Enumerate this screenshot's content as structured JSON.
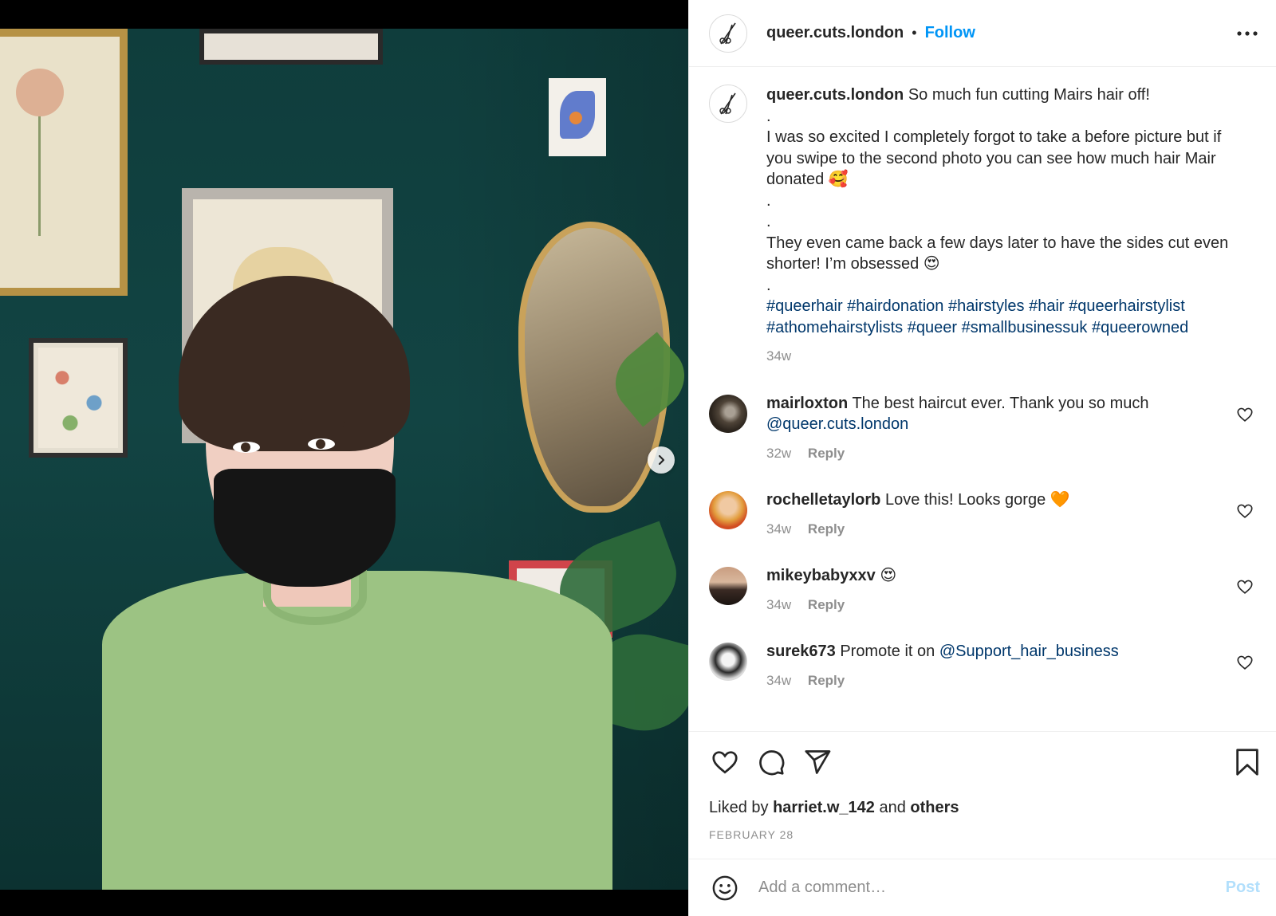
{
  "post": {
    "username": "queer.cuts.london",
    "follow_label": "Follow",
    "separator": "•",
    "media_alt": "Person with short dark haircut wearing a black face mask and green sweater in front of a dark teal wall with framed pictures"
  },
  "caption": {
    "username": "queer.cuts.london",
    "line1": "So much fun cutting Mairs hair off!",
    "dot1": ".",
    "line2": "I was so excited I completely forgot to take a before picture but if you swipe to the second photo you can see how much hair Mair donated 🥰",
    "dot2": ".",
    "dot3": ".",
    "line3": "They even came back a few days later to have the sides cut even shorter! I’m obsessed 😍",
    "dot4": ".",
    "hashtags": "#queerhair #hairdonation #hairstyles #hair #queerhairstylist #athomehairstylists #queer #smallbusinessuk #queerowned",
    "time": "34w"
  },
  "comments": [
    {
      "username": "mairloxton",
      "text": "The best haircut ever. Thank you so much",
      "mention": "@queer.cuts.london",
      "time": "32w",
      "reply": "Reply"
    },
    {
      "username": "rochelletaylorb",
      "text": "Love this! Looks gorge 🧡",
      "time": "34w",
      "reply": "Reply"
    },
    {
      "username": "mikeybabyxxv",
      "text": "😍",
      "time": "34w",
      "reply": "Reply"
    },
    {
      "username": "surek673",
      "text": "Promote it on",
      "mention": "@Support_hair_business",
      "time": "34w",
      "reply": "Reply"
    }
  ],
  "actions": {
    "liked_by_prefix": "Liked by",
    "liked_by_user": "harriet.w_142",
    "and": "and",
    "others": "others",
    "date": "FEBRUARY 28"
  },
  "add_comment": {
    "placeholder": "Add a comment…",
    "post_label": "Post"
  },
  "icons": {
    "logo": "scissors-icon",
    "more": "more-horizontal-icon",
    "carousel": "chevron-right-icon",
    "like": "heart-icon",
    "comment": "comment-icon",
    "share": "paper-plane-icon",
    "save": "bookmark-icon",
    "emoji": "smiley-icon"
  },
  "colors": {
    "accent": "#0095f6",
    "link": "#00376b",
    "muted": "#8e8e8e",
    "post_disabled": "#b2dffc"
  }
}
